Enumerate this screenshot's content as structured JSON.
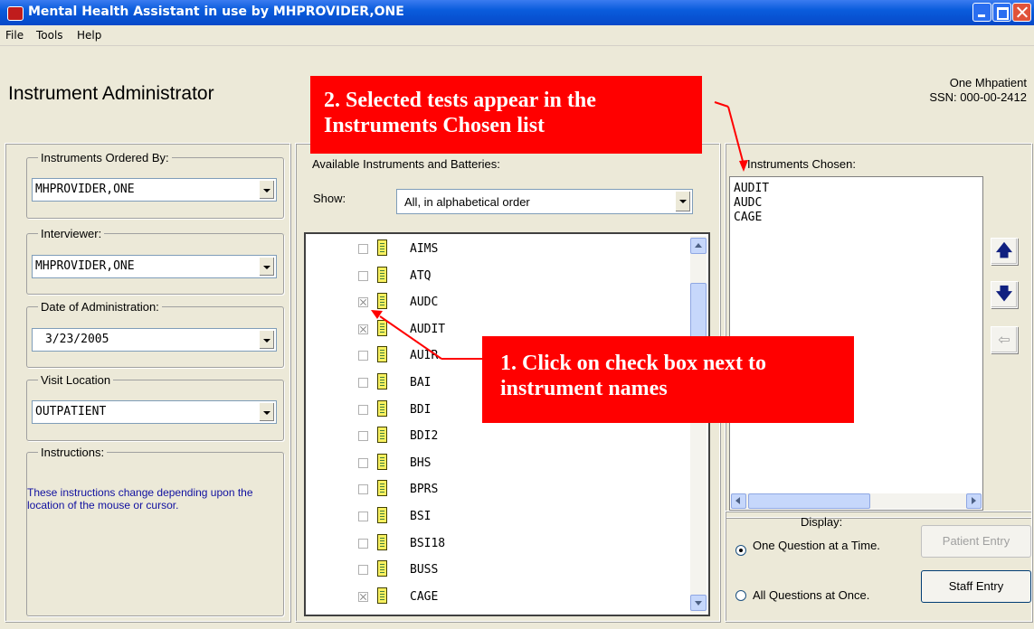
{
  "window": {
    "title": "Mental Health Assistant in use by MHPROVIDER,ONE"
  },
  "menu": [
    "File",
    "Tools",
    "Help"
  ],
  "header": {
    "page_title": "Instrument Administrator",
    "patient_name": "One Mhpatient",
    "patient_ssn": "SSN: 000-00-2412"
  },
  "left": {
    "ordered_by_label": "Instruments Ordered By:",
    "ordered_by_value": "MHPROVIDER,ONE",
    "interviewer_label": "Interviewer:",
    "interviewer_value": "MHPROVIDER,ONE",
    "date_label": "Date of Administration:",
    "date_value": "3/23/2005",
    "location_label": "Visit Location",
    "location_value": "OUTPATIENT",
    "instructions_label": "Instructions:",
    "instructions_text": "These instructions change depending upon the location of the mouse or cursor."
  },
  "available": {
    "label": "Available Instruments and Batteries:",
    "show_label": "Show:",
    "show_value": "All, in alphabetical order",
    "items": [
      {
        "name": "AIMS",
        "checked": false
      },
      {
        "name": "ATQ",
        "checked": false
      },
      {
        "name": "AUDC",
        "checked": true
      },
      {
        "name": "AUDIT",
        "checked": true
      },
      {
        "name": "AUIR",
        "checked": false
      },
      {
        "name": "BAI",
        "checked": false
      },
      {
        "name": "BDI",
        "checked": false
      },
      {
        "name": "BDI2",
        "checked": false
      },
      {
        "name": "BHS",
        "checked": false
      },
      {
        "name": "BPRS",
        "checked": false
      },
      {
        "name": "BSI",
        "checked": false
      },
      {
        "name": "BSI18",
        "checked": false
      },
      {
        "name": "BUSS",
        "checked": false
      },
      {
        "name": "CAGE",
        "checked": true
      }
    ]
  },
  "chosen": {
    "label": "Instruments Chosen:",
    "items": [
      "AUDIT",
      "AUDC",
      "CAGE"
    ]
  },
  "display": {
    "label": "Display:",
    "option_one": "One Question at a Time.",
    "option_all": "All Questions at Once.",
    "patient_entry": "Patient Entry",
    "staff_entry": "Staff Entry"
  },
  "callouts": {
    "callout_2": "2. Selected tests appear in the Instruments Chosen list",
    "callout_1": "1. Click on check box next to instrument names"
  },
  "colors": {
    "callout_bg": "#ff0000",
    "titlebar": "#0a5cdc"
  }
}
